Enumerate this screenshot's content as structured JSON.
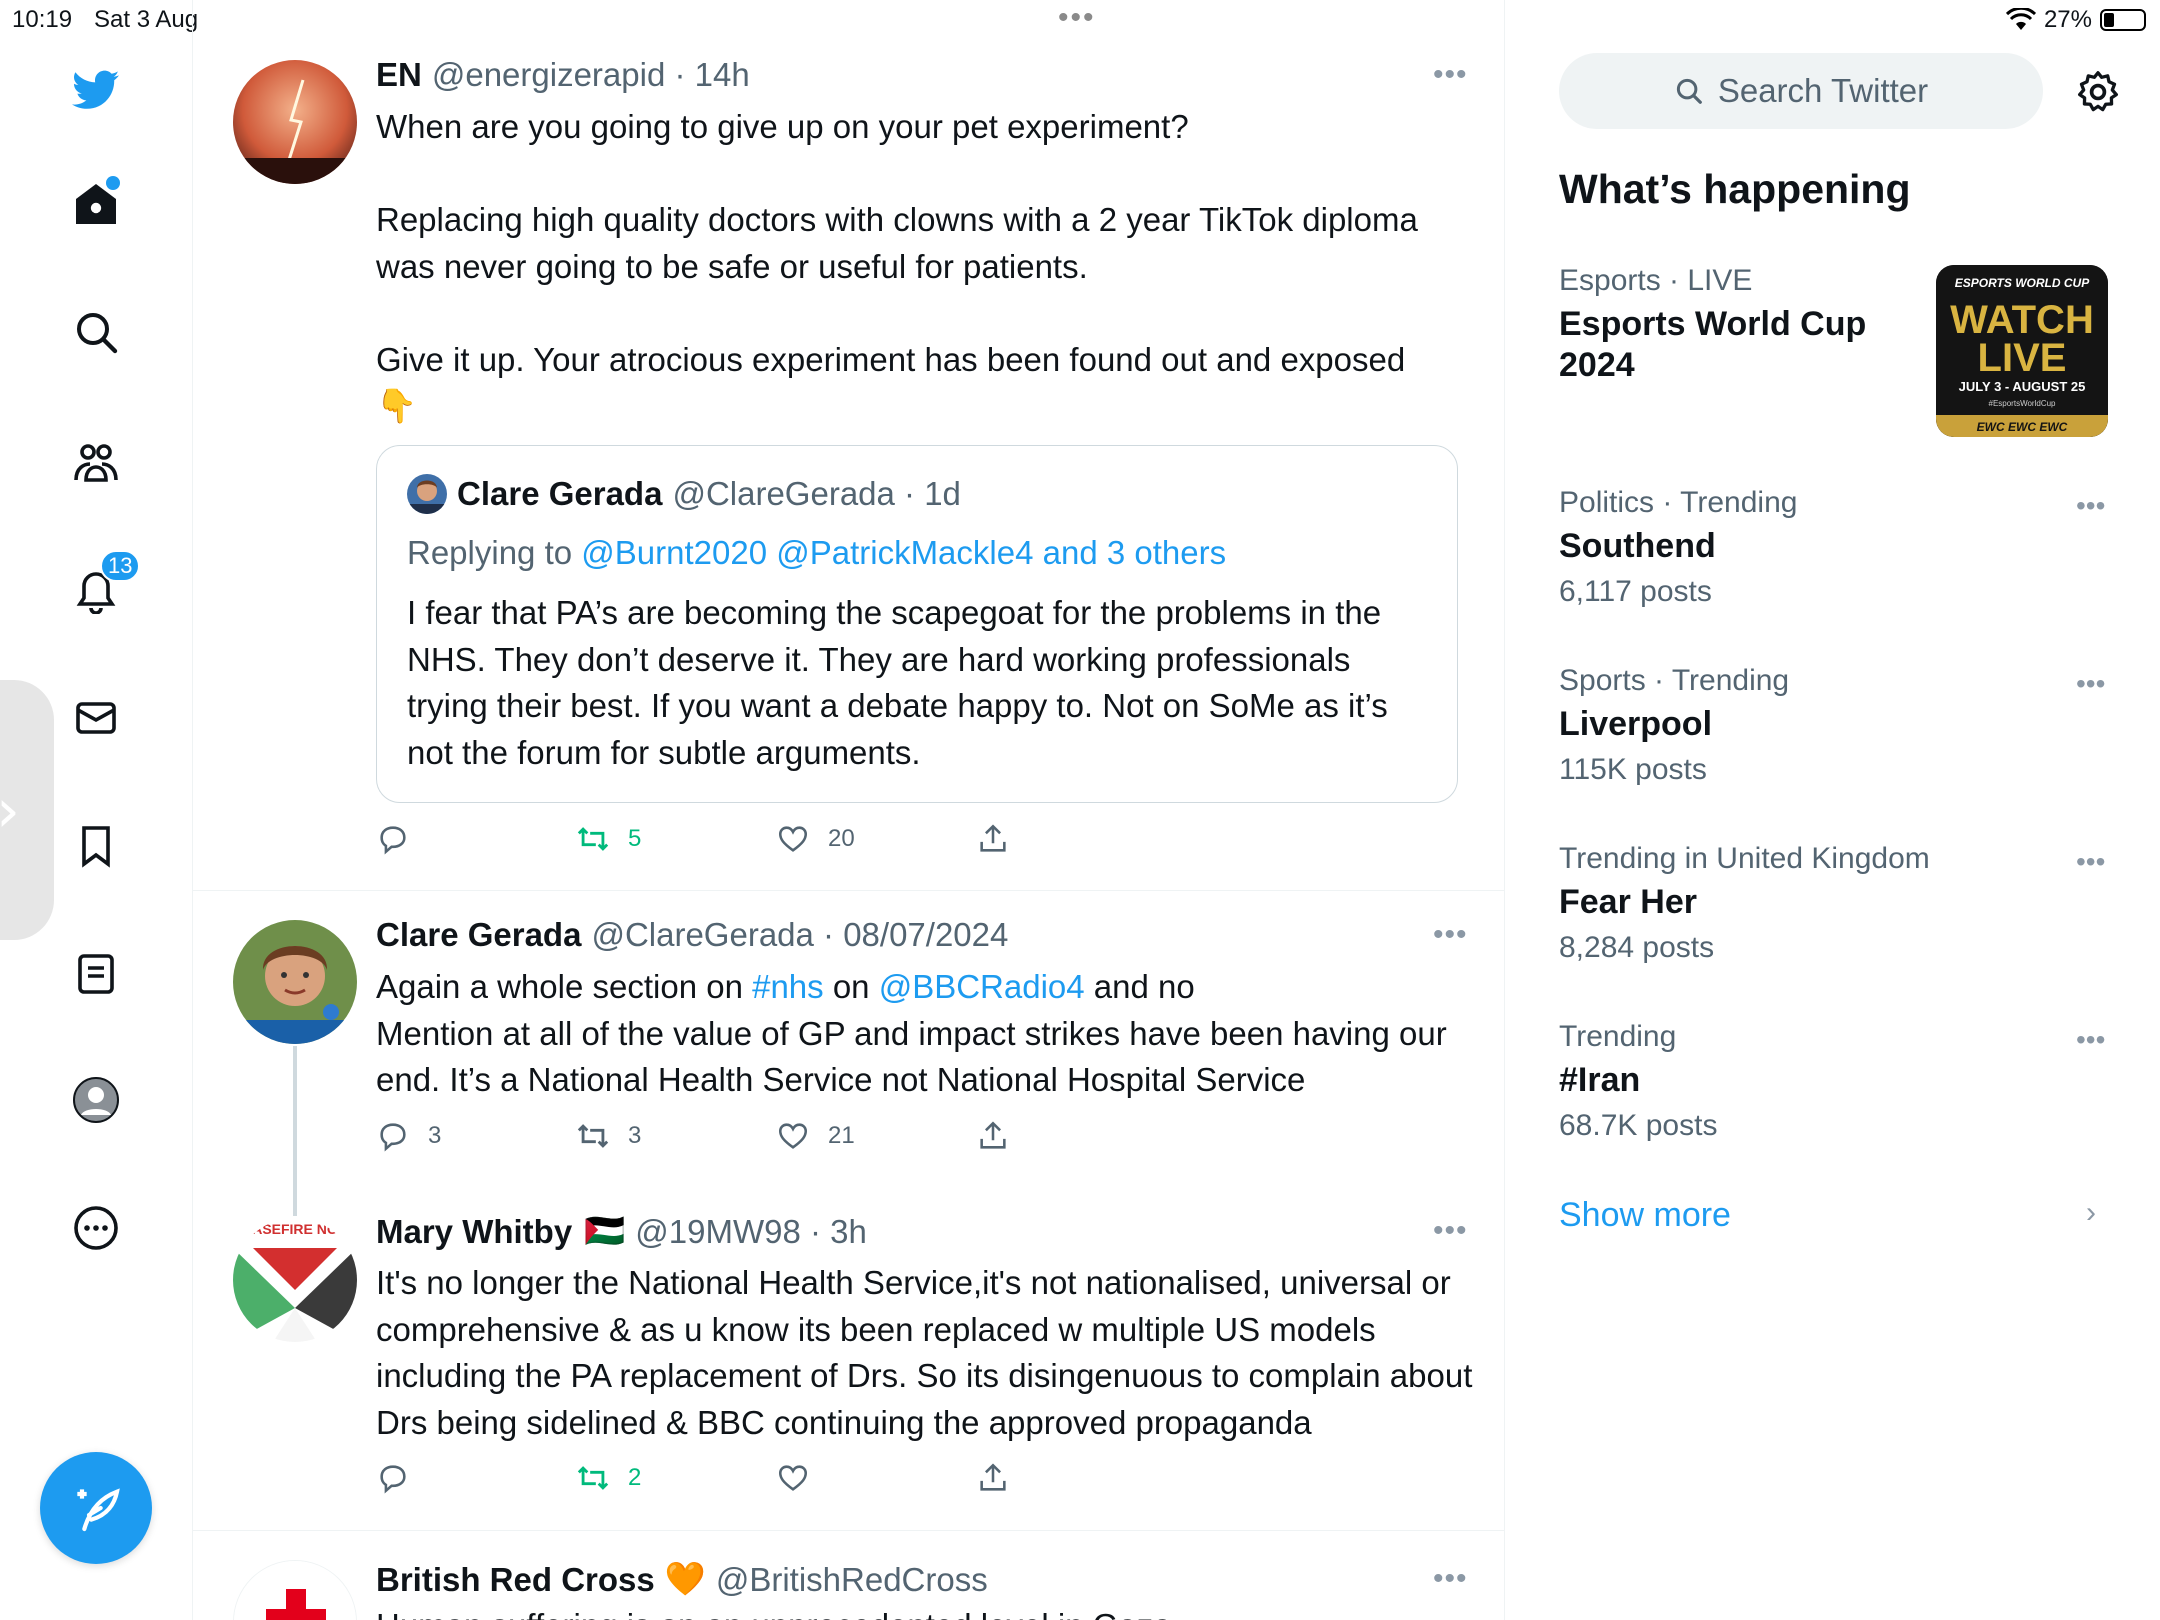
{
  "status": {
    "time": "10:19",
    "date": "Sat 3 Aug",
    "battery": "27%",
    "battery_level": 0.27
  },
  "nav": {
    "notifications_badge": "13"
  },
  "tweets": [
    {
      "name": "EN",
      "handle": "@energizerapid · 14h",
      "text": "When are you going to give up on your pet experiment?\n\nReplacing high quality doctors with clowns with a 2 year TikTok diploma was never going to be safe or useful for patients.\n\nGive it up. Your atrocious experiment has been found out and exposed\n👇",
      "quote": {
        "name": "Clare Gerada",
        "handle": "@ClareGerada · 1d",
        "replying_prefix": "Replying to ",
        "replying_to": "@Burnt2020 @PatrickMackle4 and 3 others",
        "text": "I fear that PA’s are becoming the scapegoat for the problems in the NHS. They don’t deserve it. They are hard working professionals trying their best. If you want a debate happy to.  Not on SoMe as it’s not the forum for subtle arguments."
      },
      "replies": "",
      "retweets": "5",
      "likes": "20"
    },
    {
      "name": "Clare Gerada",
      "handle": "@ClareGerada · 08/07/2024",
      "text_parts": [
        "Again a whole section on ",
        "#nhs",
        " on ",
        "@BBCRadio4",
        " and no\nMention at all of the value of GP and impact strikes have been having our end. It’s a National Health Service not National Hospital Service"
      ],
      "replies": "3",
      "retweets": "3",
      "likes": "21"
    },
    {
      "name": "Mary Whitby",
      "flag": "🇵🇸",
      "handle": "@19MW98 · 3h",
      "text": "It's no longer the National Health Service,it's not nationalised, universal or comprehensive & as u know its been replaced w multiple US models including the PA replacement of Drs. So its disingenuous to complain about Drs being sidelined & BBC continuing the approved propaganda",
      "replies": "",
      "retweets": "2",
      "likes": ""
    },
    {
      "name": "British Red Cross",
      "emoji": "🧡",
      "handle": "@BritishRedCross",
      "text": "Human suffering is on an unprecedented level in Gaza"
    }
  ],
  "sidebar": {
    "search_placeholder": "Search Twitter",
    "title": "What’s happening",
    "trends": [
      {
        "meta": "Esports · LIVE",
        "name": "Esports World Cup 2024",
        "count": ""
      },
      {
        "meta": "Politics · Trending",
        "name": "Southend",
        "count": "6,117 posts"
      },
      {
        "meta": "Sports · Trending",
        "name": "Liverpool",
        "count": "115K posts"
      },
      {
        "meta": "Trending in United Kingdom",
        "name": "Fear Her",
        "count": "8,284 posts"
      },
      {
        "meta": "Trending",
        "name": "#Iran",
        "count": "68.7K posts"
      }
    ],
    "esports_image": {
      "line1": "ESPORTS WORLD CUP",
      "line2": "WATCH",
      "line3": "LIVE",
      "line4": "JULY 3 - AUGUST 25",
      "line5": "#EsportsWorldCup",
      "line6": "EWC EWC EWC"
    },
    "show_more": "Show more"
  },
  "colors": {
    "accent": "#1d9bf0",
    "retweet": "#00ba7c",
    "muted": "#536471"
  }
}
